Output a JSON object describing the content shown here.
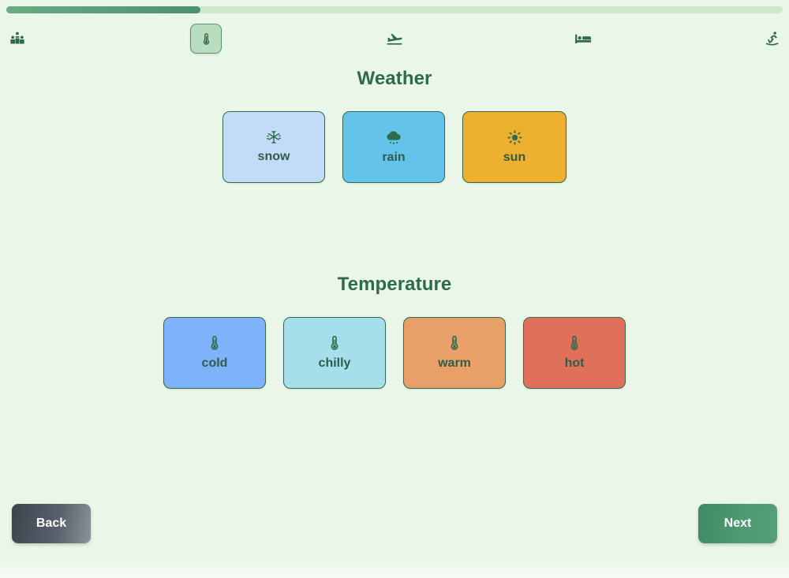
{
  "progress": {
    "percent": 25,
    "fill_color": "#4d9171",
    "track_color": "#cfe7ce"
  },
  "steps": [
    {
      "id": "travelers",
      "icon": "people-group-icon",
      "active": false
    },
    {
      "id": "weather",
      "icon": "thermometer-icon",
      "active": true
    },
    {
      "id": "flight",
      "icon": "plane-landing-icon",
      "active": false
    },
    {
      "id": "hotel",
      "icon": "bed-icon",
      "active": false
    },
    {
      "id": "activities",
      "icon": "person-skiing-icon",
      "active": false
    }
  ],
  "weather": {
    "title": "Weather",
    "options": [
      {
        "label": "snow",
        "icon": "snowflake-icon",
        "color": "#c2dcf7"
      },
      {
        "label": "rain",
        "icon": "cloud-rain-icon",
        "color": "#63c3eb"
      },
      {
        "label": "sun",
        "icon": "sun-icon",
        "color": "#eeb02f"
      }
    ]
  },
  "temperature": {
    "title": "Temperature",
    "options": [
      {
        "label": "cold",
        "icon": "thermometer-icon",
        "color": "#7eb2fb"
      },
      {
        "label": "chilly",
        "icon": "thermometer-icon",
        "color": "#a5dfec"
      },
      {
        "label": "warm",
        "icon": "thermometer-icon",
        "color": "#e89f68"
      },
      {
        "label": "hot",
        "icon": "thermometer-icon",
        "color": "#e0705a"
      }
    ]
  },
  "footer": {
    "back_label": "Back",
    "next_label": "Next"
  },
  "theme": {
    "background": "#eaf7e8",
    "heading_color": "#2e6b4c",
    "card_border": "#35694f",
    "next_button_color": "#4e9a72",
    "back_button_color": "#5a636d"
  }
}
